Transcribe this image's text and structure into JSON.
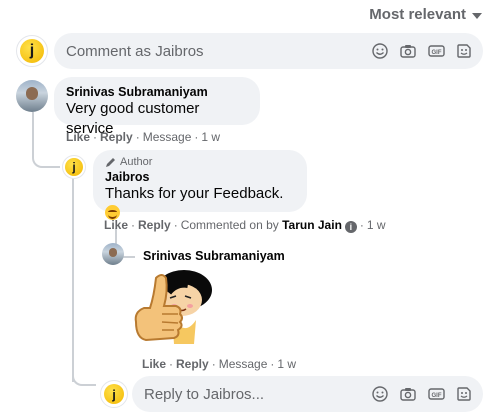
{
  "sort": {
    "label": "Most relevant"
  },
  "top_input": {
    "placeholder": "Comment as Jaibros"
  },
  "avatar_letter": "j",
  "comment1": {
    "author": "Srinivas Subramaniyam",
    "text": "Very good customer service",
    "like": "Like",
    "reply": "Reply",
    "meta": "Message",
    "time": "1 w"
  },
  "comment2": {
    "badge": "Author",
    "author": "Jaibros",
    "text": "Thanks for your Feedback.",
    "like": "Like",
    "reply": "Reply",
    "commented_on_by": "Commented on by",
    "commenter": "Tarun Jain",
    "time": "1 w"
  },
  "comment3": {
    "author": "Srinivas Subramaniyam",
    "like": "Like",
    "reply": "Reply",
    "meta": "Message",
    "time": "1 w"
  },
  "reply_input": {
    "placeholder": "Reply to Jaibros..."
  },
  "icons": [
    "smiley-icon",
    "camera-icon",
    "gif-icon",
    "sticker-icon"
  ]
}
